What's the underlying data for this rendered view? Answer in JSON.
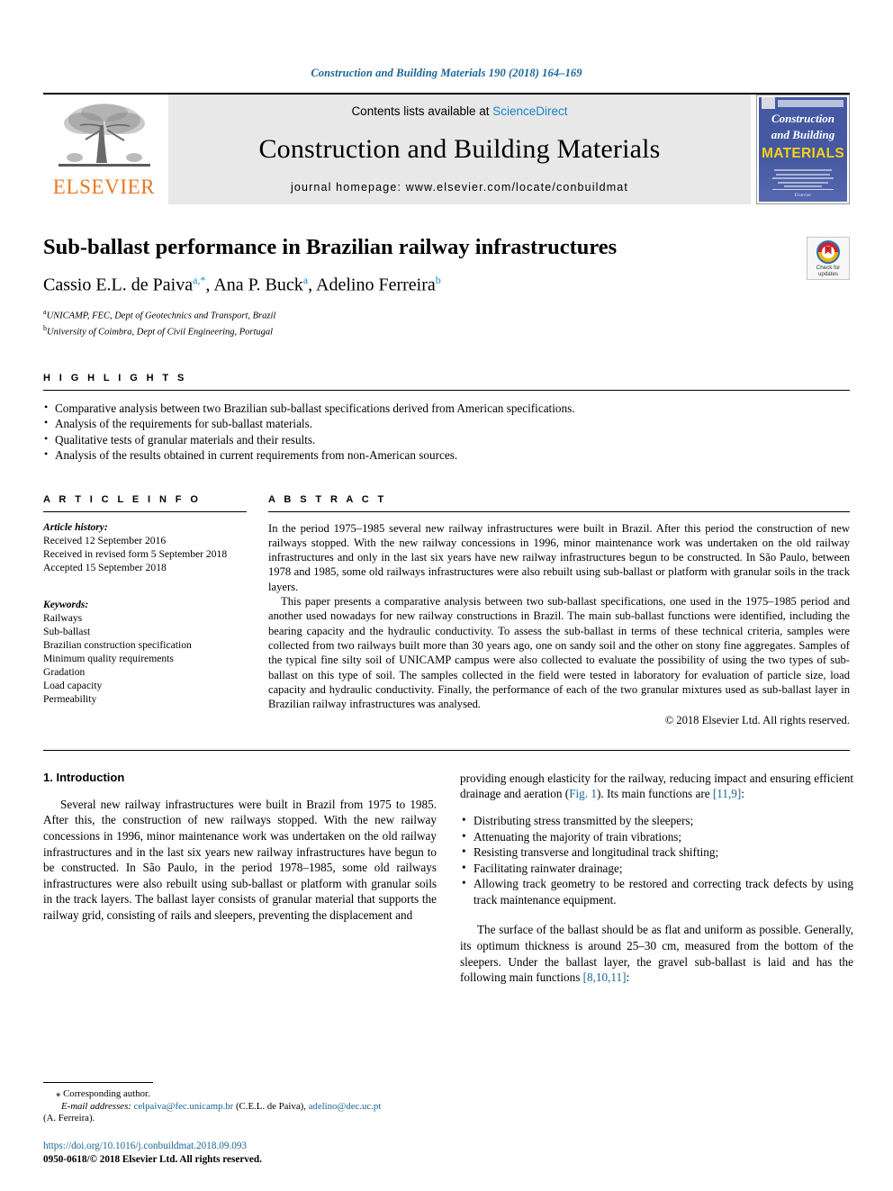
{
  "running_head": "Construction and Building Materials 190 (2018) 164–169",
  "masthead": {
    "publisher": "ELSEVIER",
    "contents_prefix": "Contents lists available at ",
    "contents_link": "ScienceDirect",
    "journal_name": "Construction and Building Materials",
    "homepage": "journal homepage: www.elsevier.com/locate/conbuildmat",
    "cover_line1": "Construction",
    "cover_line2": "and Building",
    "cover_line3": "MATERIALS",
    "cover_footer": "Elsevier"
  },
  "article": {
    "title": "Sub-ballast performance in Brazilian railway infrastructures",
    "authors": [
      {
        "name": "Cassio E.L. de Paiva",
        "marks": "a,*"
      },
      {
        "name": "Ana P. Buck",
        "marks": "a"
      },
      {
        "name": "Adelino Ferreira",
        "marks": "b"
      }
    ],
    "affiliations": [
      {
        "mark": "a",
        "text": "UNICAMP, FEC, Dept of Geotechnics and Transport, Brazil"
      },
      {
        "mark": "b",
        "text": "University of Coimbra, Dept of Civil Engineering, Portugal"
      }
    ],
    "crossmark_line1": "Check for",
    "crossmark_line2": "updates"
  },
  "highlights": {
    "heading": "H I G H L I G H T S",
    "items": [
      "Comparative analysis between two Brazilian sub-ballast specifications derived from American specifications.",
      "Analysis of the requirements for sub-ballast materials.",
      "Qualitative tests of granular materials and their results.",
      "Analysis of the results obtained in current requirements from non-American sources."
    ]
  },
  "article_info": {
    "heading": "A R T I C L E   I N F O",
    "history_label": "Article history:",
    "history": [
      "Received 12 September 2016",
      "Received in revised form 5 September 2018",
      "Accepted 15 September 2018"
    ],
    "keywords_label": "Keywords:",
    "keywords": [
      "Railways",
      "Sub-ballast",
      "Brazilian construction specification",
      "Minimum quality requirements",
      "Gradation",
      "Load capacity",
      "Permeability"
    ]
  },
  "abstract": {
    "heading": "A B S T R A C T",
    "paragraphs": [
      "In the period 1975–1985 several new railway infrastructures were built in Brazil. After this period the construction of new railways stopped. With the new railway concessions in 1996, minor maintenance work was undertaken on the old railway infrastructures and only in the last six years have new railway infrastructures begun to be constructed. In São Paulo, between 1978 and 1985, some old railways infrastructures were also rebuilt using sub-ballast or platform with granular soils in the track layers.",
      "This paper presents a comparative analysis between two sub-ballast specifications, one used in the 1975–1985 period and another used nowadays for new railway constructions in Brazil. The main sub-ballast functions were identified, including the bearing capacity and the hydraulic conductivity. To assess the sub-ballast in terms of these technical criteria, samples were collected from two railways built more than 30 years ago, one on sandy soil and the other on stony fine aggregates. Samples of the typical fine silty soil of UNICAMP campus were also collected to evaluate the possibility of using the two types of sub-ballast on this type of soil. The samples collected in the field were tested in laboratory for evaluation of particle size, load capacity and hydraulic conductivity. Finally, the performance of each of the two granular mixtures used as sub-ballast layer in Brazilian railway infrastructures was analysed."
    ],
    "copyright": "© 2018 Elsevier Ltd. All rights reserved."
  },
  "introduction": {
    "heading": "1. Introduction",
    "left_paragraph": "Several new railway infrastructures were built in Brazil from 1975 to 1985. After this, the construction of new railways stopped. With the new railway concessions in 1996, minor maintenance work was undertaken on the old railway infrastructures and in the last six years new railway infrastructures have begun to be constructed. In São Paulo, in the period 1978–1985, some old railways infrastructures were also rebuilt using sub-ballast or platform with granular soils in the track layers. The ballast layer consists of granular material that supports the railway grid, consisting of rails and sleepers, preventing the displacement and",
    "right_paragraph_a": "providing enough elasticity for the railway, reducing impact and ensuring efficient drainage and aeration (",
    "right_fig_ref": "Fig. 1",
    "right_paragraph_b": "). Its main functions are ",
    "right_ref_119": "[11,9]",
    "right_paragraph_c": ":",
    "functions_list": [
      "Distributing stress transmitted by the sleepers;",
      "Attenuating the majority of train vibrations;",
      "Resisting transverse and longitudinal track shifting;",
      "Facilitating rainwater drainage;",
      "Allowing track geometry to be restored and correcting track defects by using track maintenance equipment."
    ],
    "last_paragraph_a": "The surface of the ballast should be as flat and uniform as possible. Generally, its optimum thickness is around 25–30 cm, measured from the bottom of the sleepers. Under the ballast layer, the gravel sub-ballast is laid and has the following main functions ",
    "last_ref": "[8,10,11]",
    "last_paragraph_b": ":"
  },
  "footnote": {
    "corresponding_marker": "⁎",
    "corresponding_text": "Corresponding author.",
    "email_label": "E-mail addresses:",
    "email1": "celpaiva@fec.unicamp.br",
    "email1_owner": "(C.E.L. de Paiva),",
    "email2": "adelino@dec.uc.pt",
    "email2_owner": "(A. Ferreira).",
    "doi": "https://doi.org/10.1016/j.conbuildmat.2018.09.093",
    "issn_line_bold": "0950-0618/",
    "issn_line_rest": "© 2018 Elsevier Ltd. All rights reserved."
  },
  "colors": {
    "link_blue": "#1a6496",
    "sciencedirect_blue": "#1a85c8",
    "elsevier_orange": "#E87722",
    "cover_blue": "#4458a6",
    "cover_yellow": "#f5d117"
  }
}
